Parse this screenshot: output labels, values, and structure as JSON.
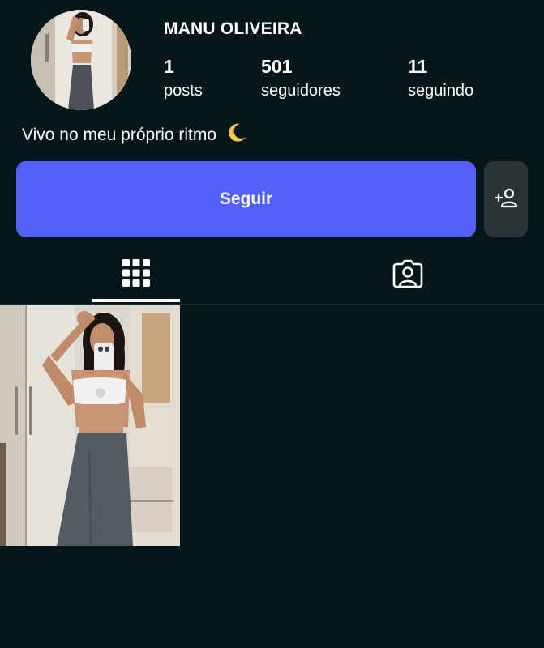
{
  "profile": {
    "username": "MANU OLIVEIRA",
    "bio": "Vivo no meu próprio ritmo",
    "bio_emoji": "crescent-moon-icon"
  },
  "stats": {
    "posts": {
      "value": "1",
      "label": "posts"
    },
    "followers": {
      "value": "501",
      "label": "seguidores"
    },
    "following": {
      "value": "11",
      "label": "seguindo"
    }
  },
  "actions": {
    "follow_label": "Seguir",
    "add_user_icon": "add-user-icon"
  },
  "tabs": [
    {
      "icon": "grid-icon",
      "active": true
    },
    {
      "icon": "tagged-person-icon",
      "active": false
    }
  ],
  "colors": {
    "background": "#03171a",
    "accent": "#5160f8",
    "secondary_button": "#2a3335",
    "text": "#ffffff"
  }
}
